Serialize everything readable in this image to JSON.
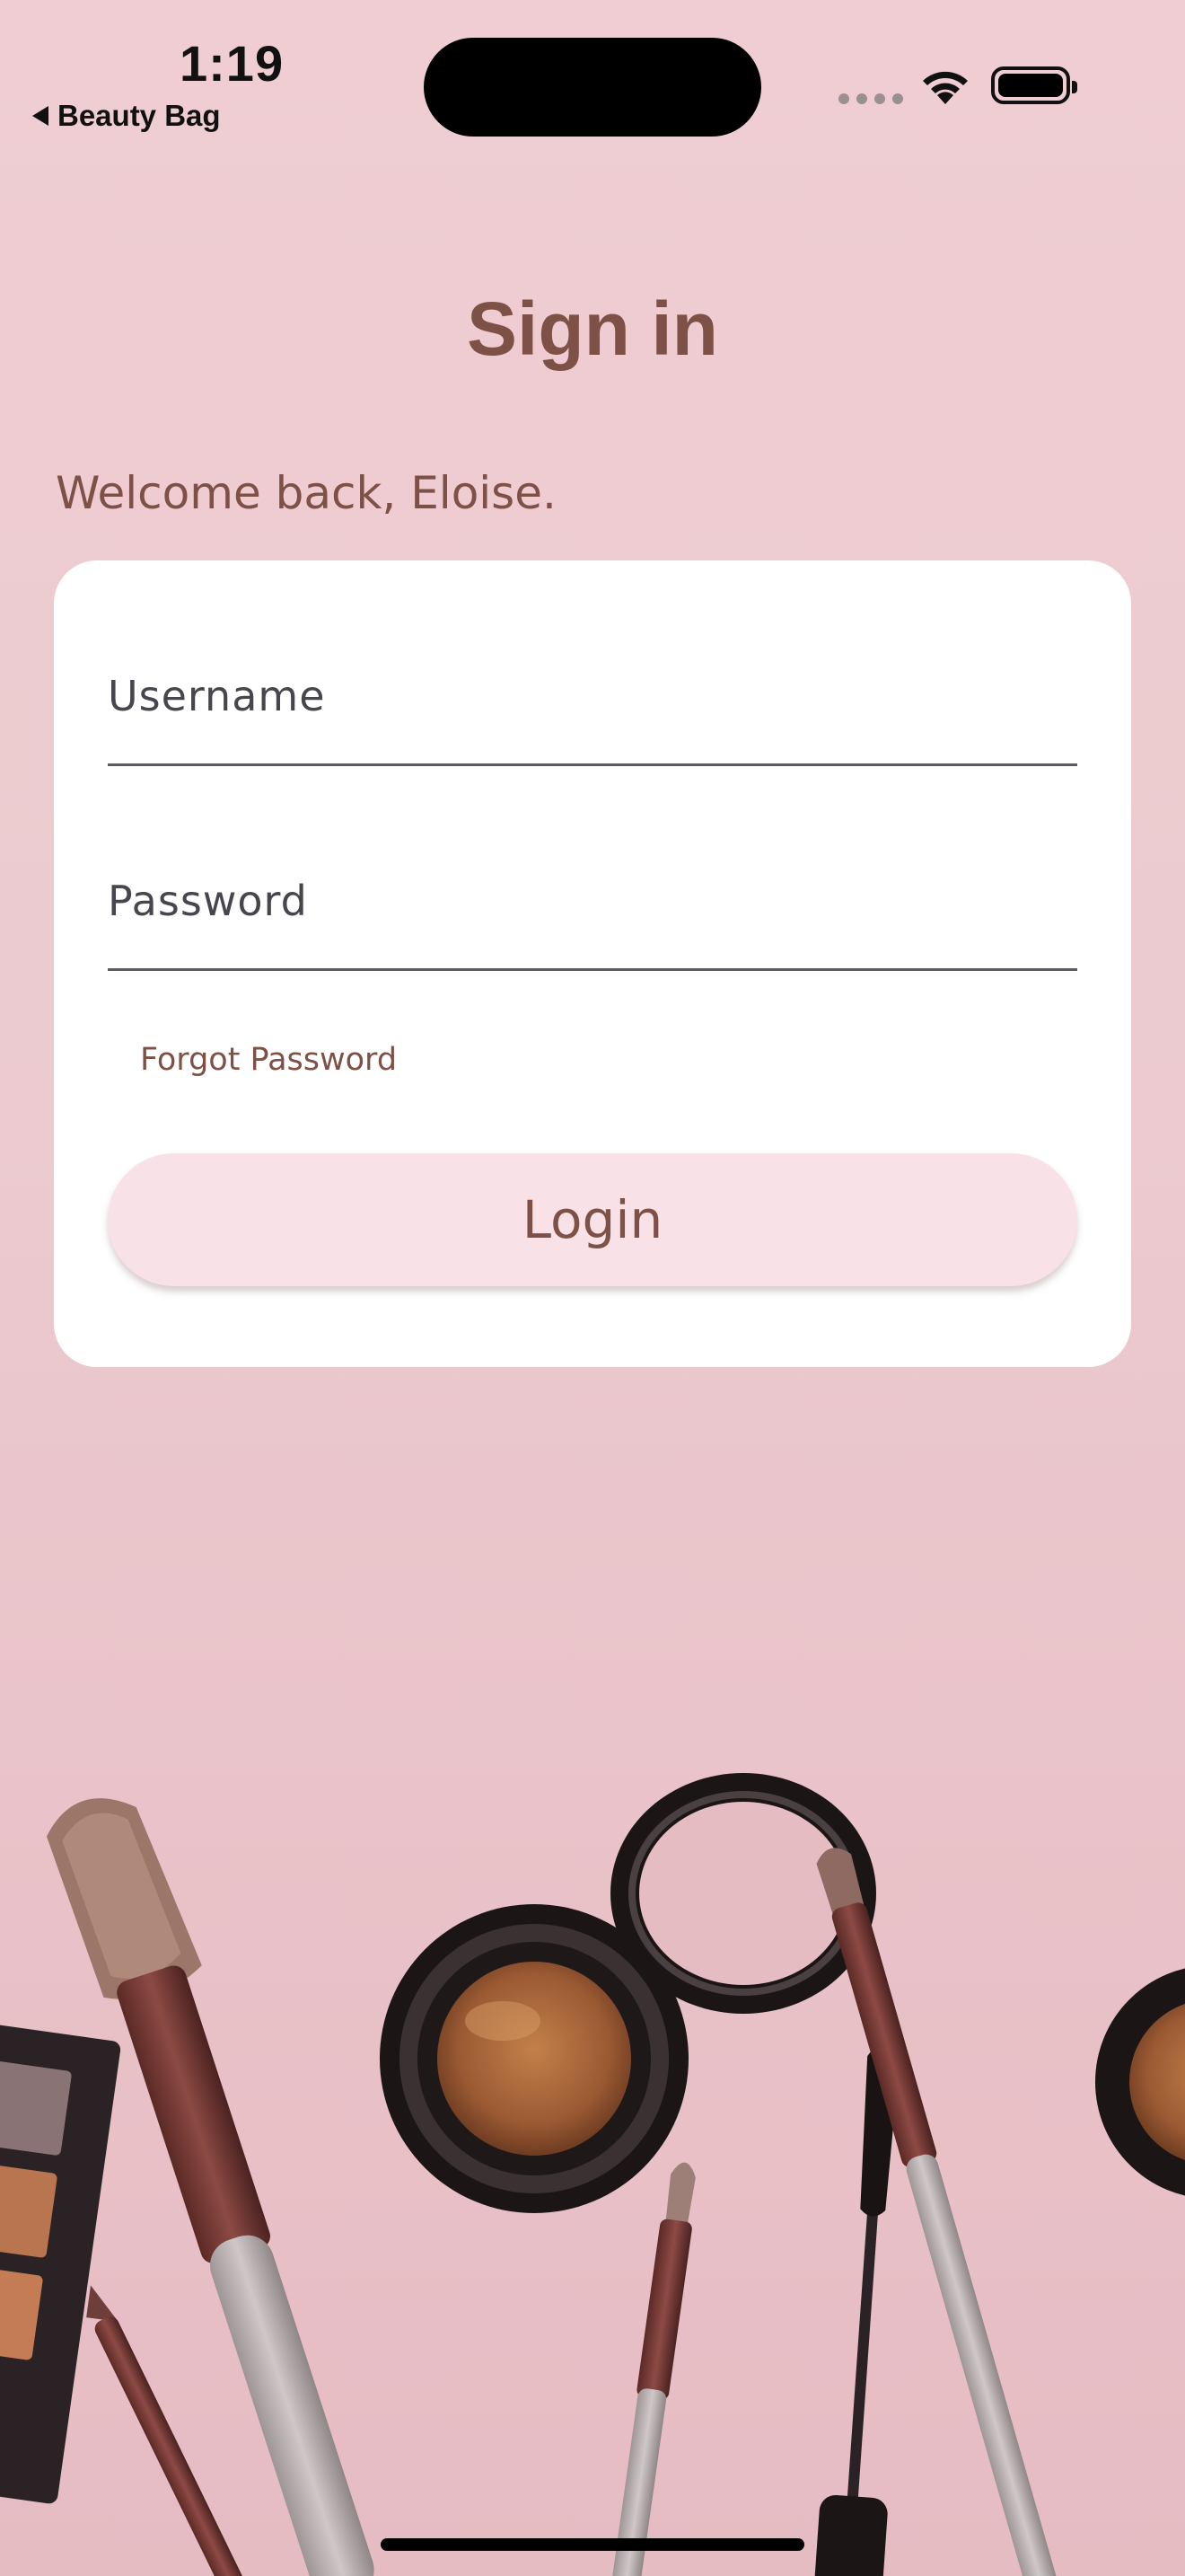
{
  "status_bar": {
    "time": "1:19",
    "back_label": "Beauty Bag"
  },
  "screen": {
    "title": "Sign in",
    "welcome": "Welcome back, Eloise."
  },
  "form": {
    "username_placeholder": "Username",
    "password_placeholder": "Password",
    "forgot_label": "Forgot Password",
    "login_label": "Login"
  },
  "colors": {
    "accent_text": "#7e5146",
    "button_bg": "#f9e2e7",
    "background": "#ecc9ce"
  }
}
